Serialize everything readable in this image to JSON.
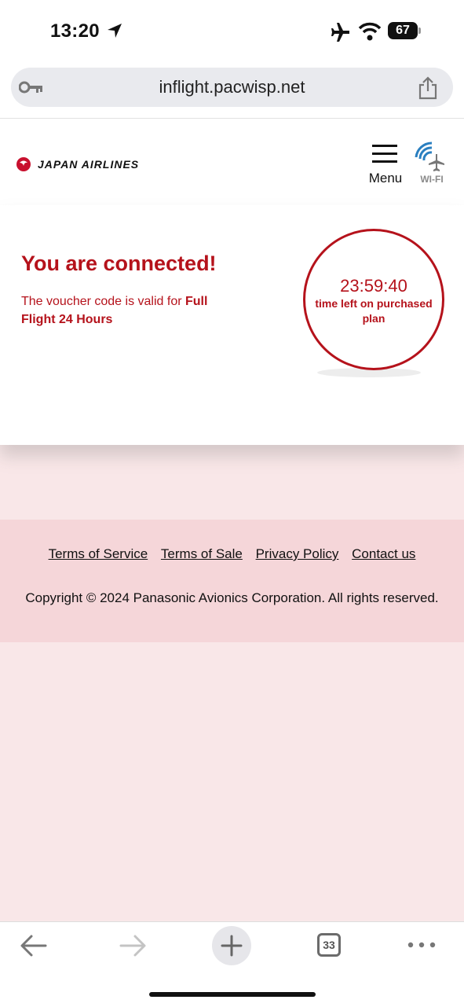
{
  "status_bar": {
    "time": "13:20",
    "battery": "67"
  },
  "browser": {
    "url": "inflight.pacwisp.net",
    "tab_count": "33"
  },
  "header": {
    "brand": "JAPAN AIRLINES",
    "menu_label": "Menu",
    "wifi_label": "WI-FI"
  },
  "main": {
    "title": "You are connected!",
    "voucher_prefix": "The voucher code is valid for ",
    "voucher_plan": "Full Flight 24 Hours",
    "timer_value": "23:59:40",
    "timer_caption": "time left on purchased plan"
  },
  "footer": {
    "links": [
      "Terms of Service",
      "Terms of Sale",
      "Privacy Policy",
      "Contact us"
    ],
    "copyright": "Copyright © 2024 Panasonic Avionics Corporation. All rights reserved."
  },
  "colors": {
    "brand_red": "#b5121b",
    "page_bg": "#f9e7e8",
    "footer_bg": "#f5d6d9"
  }
}
